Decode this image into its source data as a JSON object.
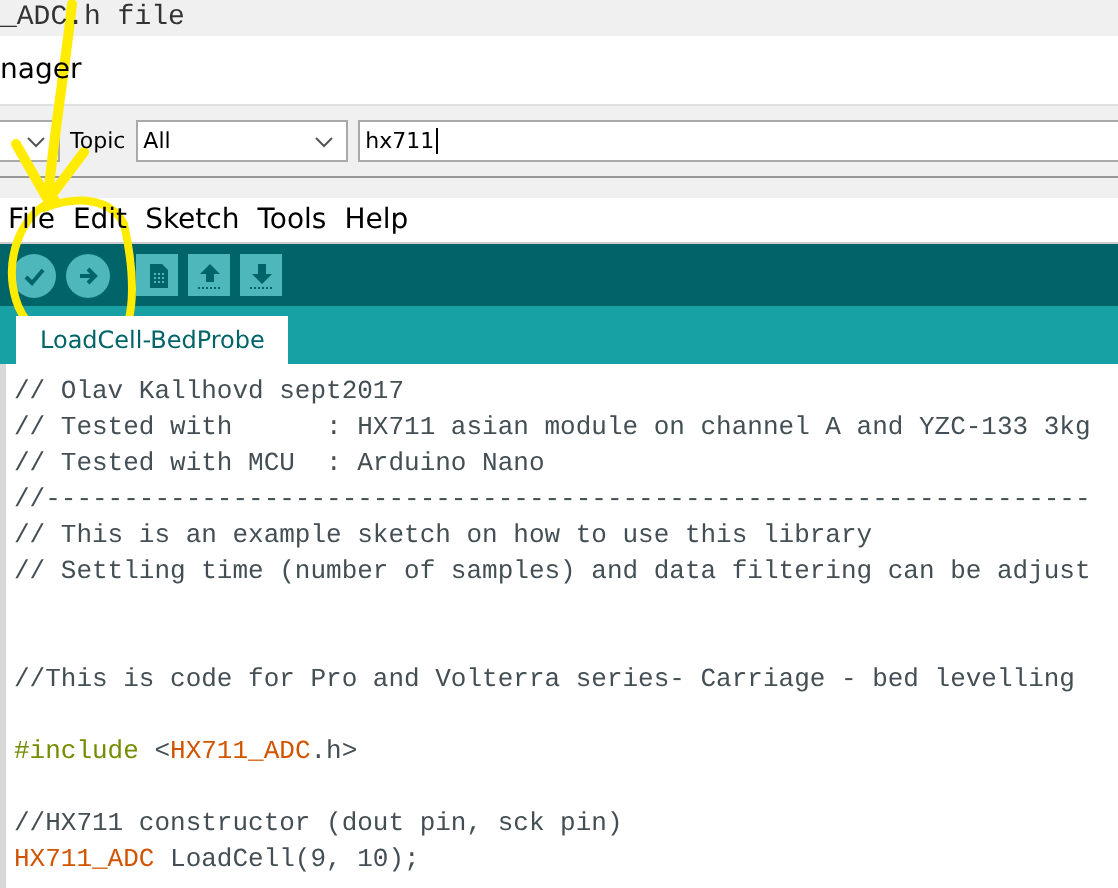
{
  "background_window": {
    "title": "_ADC.h file"
  },
  "library_manager": {
    "title": "nager",
    "filters": [
      {
        "kind": "dropdown"
      },
      {
        "kind": "label",
        "text": "Topic"
      },
      {
        "kind": "dropdown",
        "value": "All"
      },
      {
        "kind": "search",
        "value": "hx711"
      }
    ]
  },
  "menu_bar": [
    "File",
    "Edit",
    "Sketch",
    "Tools",
    "Help"
  ],
  "toolbar": [
    {
      "kind": "verify"
    },
    {
      "kind": "upload"
    },
    {
      "kind": "new"
    },
    {
      "kind": "open"
    },
    {
      "kind": "save"
    }
  ],
  "tabs": [
    {
      "label": "LoadCell-BedProbe",
      "selected": true
    }
  ],
  "editor": {
    "lines": [
      {
        "kind": "code",
        "tokens": [
          {
            "kind": "comment",
            "text": "// Olav Kallhovd sept2017"
          }
        ]
      },
      {
        "kind": "code",
        "tokens": [
          {
            "kind": "comment",
            "text": "// Tested with      : HX711 asian module on channel A and YZC-133 3kg"
          }
        ]
      },
      {
        "kind": "code",
        "tokens": [
          {
            "kind": "comment",
            "text": "// Tested with MCU  : Arduino Nano"
          }
        ]
      },
      {
        "kind": "code",
        "tokens": [
          {
            "kind": "comment",
            "text": "//-------------------------------------------------------------------"
          }
        ]
      },
      {
        "kind": "code",
        "tokens": [
          {
            "kind": "comment",
            "text": "// This is an example sketch on how to use this library"
          }
        ]
      },
      {
        "kind": "code",
        "tokens": [
          {
            "kind": "comment",
            "text": "// Settling time (number of samples) and data filtering can be adjust"
          }
        ]
      },
      {
        "kind": "blank"
      },
      {
        "kind": "blank"
      },
      {
        "kind": "code",
        "tokens": [
          {
            "kind": "comment",
            "text": "//This is code for Pro and Volterra series- Carriage - bed levelling"
          }
        ]
      },
      {
        "kind": "blank"
      },
      {
        "kind": "code",
        "tokens": [
          {
            "kind": "preprocessor",
            "text": "#include"
          },
          {
            "kind": "plain",
            "text": " <"
          },
          {
            "kind": "type",
            "text": "HX711_ADC"
          },
          {
            "kind": "plain",
            "text": ".h>"
          }
        ]
      },
      {
        "kind": "blank"
      },
      {
        "kind": "code",
        "tokens": [
          {
            "kind": "comment",
            "text": "//HX711 constructor (dout pin, sck pin)"
          }
        ]
      },
      {
        "kind": "code",
        "tokens": [
          {
            "kind": "type",
            "text": "HX711_ADC"
          },
          {
            "kind": "plain",
            "text": " LoadCell(9, 10);"
          }
        ]
      }
    ]
  },
  "annotations": {
    "arrow": true,
    "circle": true
  }
}
